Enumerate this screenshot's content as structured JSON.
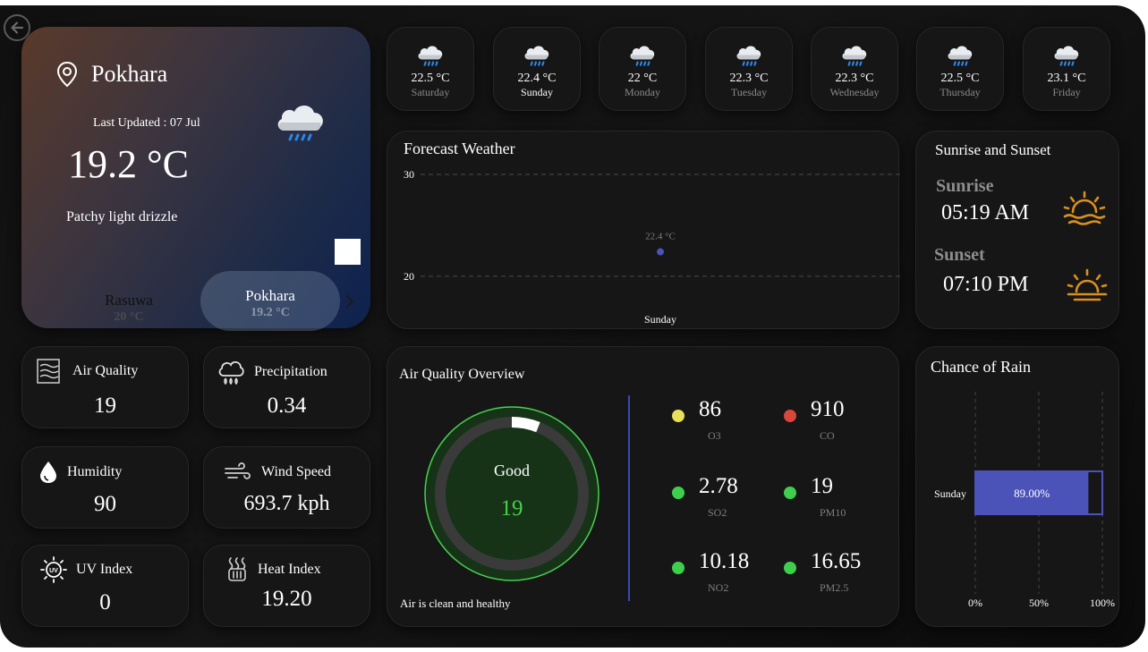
{
  "main": {
    "city": "Pokhara",
    "last_updated": "Last Updated : 07 Jul",
    "temp": "19.2 °C",
    "condition": "Patchy light drizzle",
    "icon": "cloud-rain-icon",
    "locations": [
      {
        "name": "Rasuwa",
        "temp": "20 °C"
      },
      {
        "name": "Pokhara",
        "temp": "19.2 °C"
      }
    ]
  },
  "days": [
    {
      "temp": "22.5 °C",
      "name": "Saturday",
      "active": false
    },
    {
      "temp": "22.4 °C",
      "name": "Sunday",
      "active": true
    },
    {
      "temp": "22 °C",
      "name": "Monday",
      "active": false
    },
    {
      "temp": "22.3 °C",
      "name": "Tuesday",
      "active": false
    },
    {
      "temp": "22.3 °C",
      "name": "Wednesday",
      "active": false
    },
    {
      "temp": "22.5 °C",
      "name": "Thursday",
      "active": false
    },
    {
      "temp": "23.1 °C",
      "name": "Friday",
      "active": false
    }
  ],
  "forecast": {
    "title": "Forecast Weather",
    "chart_data": {
      "type": "scatter",
      "categories": [
        "Sunday"
      ],
      "values": [
        22.4
      ],
      "data_labels": [
        "22.4 °C"
      ],
      "yticks": [
        "30",
        "20"
      ],
      "ylim": [
        12,
        30
      ],
      "grid": true,
      "color": "#4b52b8"
    }
  },
  "sun": {
    "title": "Sunrise and Sunset",
    "sunrise_label": "Sunrise",
    "sunrise_time": "05:19 AM",
    "sunset_label": "Sunset",
    "sunset_time": "07:10 PM",
    "icon_color": "#d9901f"
  },
  "metrics": {
    "air_quality": {
      "label": "Air Quality",
      "value": "19"
    },
    "precipitation": {
      "label": "Precipitation",
      "value": "0.34"
    },
    "humidity": {
      "label": "Humidity",
      "value": "90"
    },
    "wind_speed": {
      "label": "Wind Speed",
      "value": "693.7 kph"
    },
    "uv_index": {
      "label": "UV Index",
      "value": "0"
    },
    "heat_index": {
      "label": "Heat Index",
      "value": "19.20"
    }
  },
  "aq_overview": {
    "title": "Air Quality Overview",
    "status": "Good",
    "value": "19",
    "gauge_fraction": 0.06,
    "caption": "Air is clean and healthy",
    "pollutants": [
      {
        "value": "86",
        "name": "O3",
        "color": "#e8e05a"
      },
      {
        "value": "910",
        "name": "CO",
        "color": "#d9463c"
      },
      {
        "value": "2.78",
        "name": "SO2",
        "color": "#3ecf4c"
      },
      {
        "value": "19",
        "name": "PM10",
        "color": "#3ecf4c"
      },
      {
        "value": "10.18",
        "name": "NO2",
        "color": "#3ecf4c"
      },
      {
        "value": "16.65",
        "name": "PM2.5",
        "color": "#3ecf4c"
      }
    ]
  },
  "rain": {
    "title": "Chance of Rain",
    "chart_data": {
      "type": "bar",
      "orientation": "horizontal",
      "categories": [
        "Sunday"
      ],
      "values": [
        89.0
      ],
      "data_labels": [
        "89.00%"
      ],
      "xticks": [
        "0%",
        "50%",
        "100%"
      ],
      "xlim": [
        0,
        100
      ],
      "color": "#4b52b8"
    }
  }
}
